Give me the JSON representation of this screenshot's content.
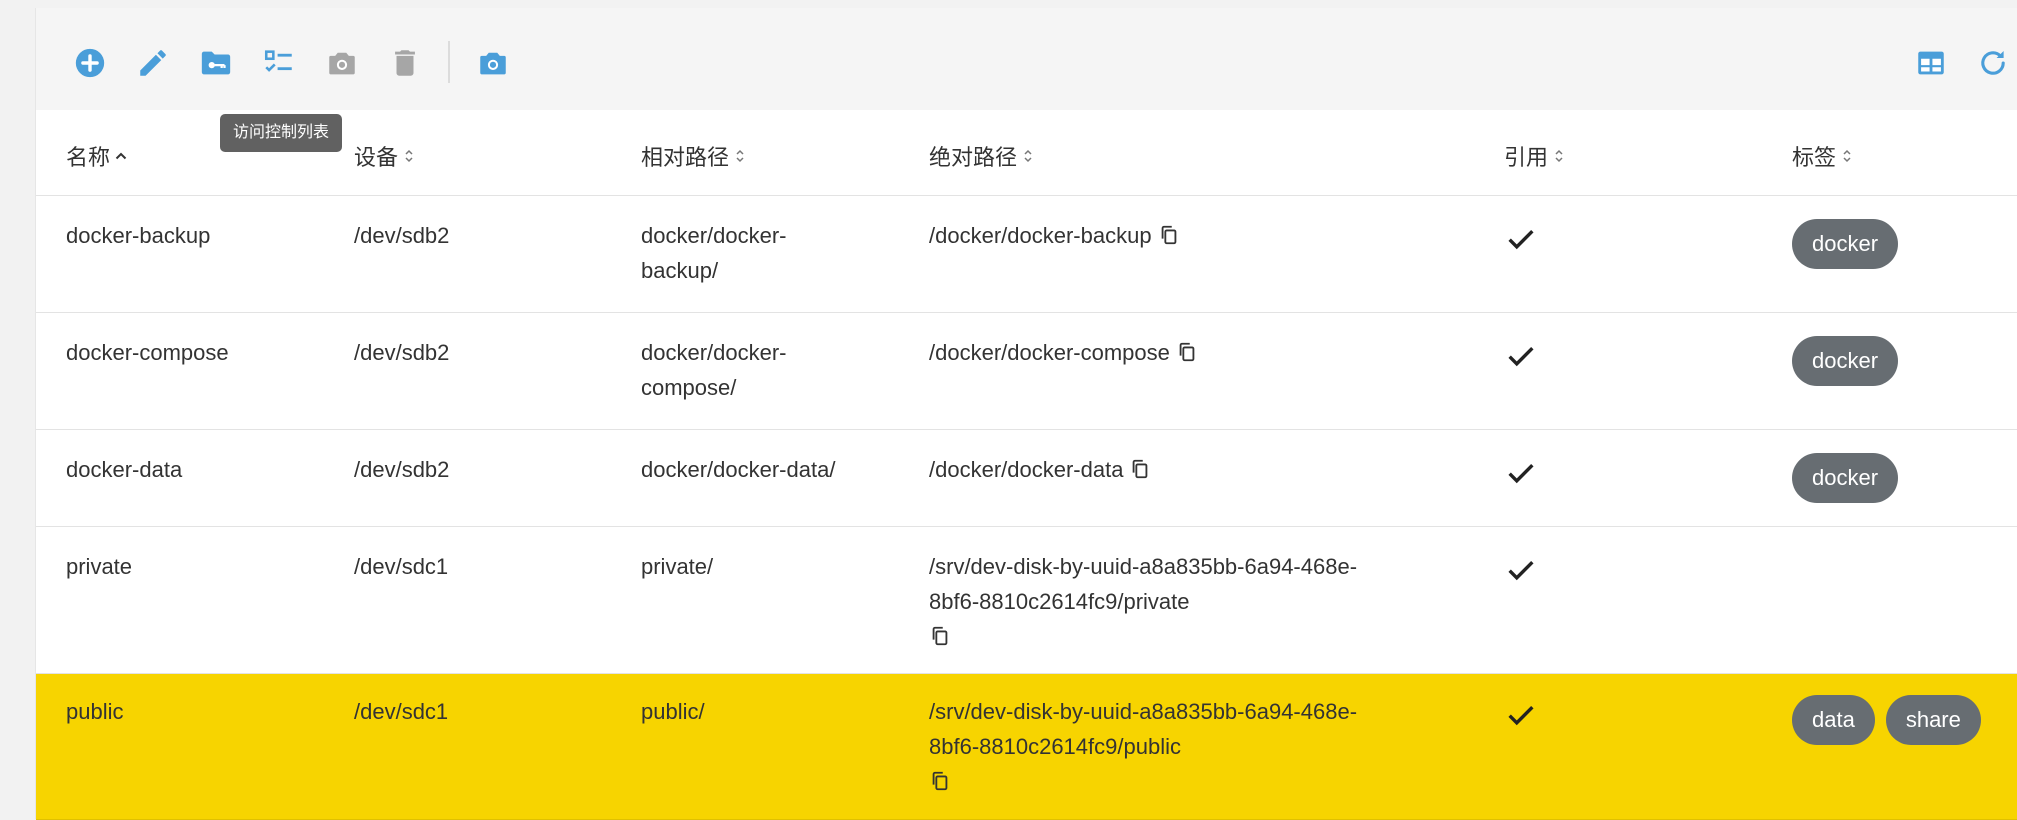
{
  "toolbar": {
    "buttons": [
      {
        "name": "add-button",
        "icon": "plus-circle-icon",
        "color": "#4a9ed9"
      },
      {
        "name": "edit-button",
        "icon": "pencil-icon",
        "color": "#4a9ed9"
      },
      {
        "name": "permissions-button",
        "icon": "folder-key-icon",
        "color": "#4a9ed9"
      },
      {
        "name": "acl-button",
        "icon": "checklist-icon",
        "color": "#4a9ed9"
      },
      {
        "name": "snapshot-button",
        "icon": "camera-icon",
        "color": "#a6a6a6"
      },
      {
        "name": "delete-button",
        "icon": "trash-icon",
        "color": "#a6a6a6"
      },
      {
        "name": "snapshots-button",
        "icon": "camera-icon",
        "color": "#4a9ed9"
      },
      {
        "name": "columns-button",
        "icon": "table-layout-icon",
        "color": "#4a9ed9"
      },
      {
        "name": "refresh-button",
        "icon": "refresh-icon",
        "color": "#4a9ed9"
      }
    ],
    "tooltip": "访问控制列表"
  },
  "columns": [
    {
      "label": "名称",
      "sort": "asc"
    },
    {
      "label": "设备",
      "sort": "none"
    },
    {
      "label": "相对路径",
      "sort": "none"
    },
    {
      "label": "绝对路径",
      "sort": "none"
    },
    {
      "label": "引用",
      "sort": "none"
    },
    {
      "label": "标签",
      "sort": "none"
    }
  ],
  "rows": [
    {
      "name": "docker-backup",
      "device": "/dev/sdb2",
      "rel1": "docker/docker-",
      "rel2": "backup/",
      "abs1": "/docker/docker-backup",
      "abs2": "",
      "referenced": true,
      "tags": [
        "docker"
      ],
      "selected": false
    },
    {
      "name": "docker-compose",
      "device": "/dev/sdb2",
      "rel1": "docker/docker-",
      "rel2": "compose/",
      "abs1": "/docker/docker-compose",
      "abs2": "",
      "referenced": true,
      "tags": [
        "docker"
      ],
      "selected": false
    },
    {
      "name": "docker-data",
      "device": "/dev/sdb2",
      "rel1": "docker/docker-data/",
      "rel2": "",
      "abs1": "/docker/docker-data",
      "abs2": "",
      "referenced": true,
      "tags": [
        "docker"
      ],
      "selected": false
    },
    {
      "name": "private",
      "device": "/dev/sdc1",
      "rel1": "private/",
      "rel2": "",
      "abs1": "/srv/dev-disk-by-uuid-a8a835bb-6a94-468e-",
      "abs2": "8bf6-8810c2614fc9/private",
      "referenced": true,
      "tags": [],
      "selected": false
    },
    {
      "name": "public",
      "device": "/dev/sdc1",
      "rel1": "public/",
      "rel2": "",
      "abs1": "/srv/dev-disk-by-uuid-a8a835bb-6a94-468e-",
      "abs2": "8bf6-8810c2614fc9/public",
      "referenced": true,
      "tags": [
        "data",
        "share"
      ],
      "selected": true
    }
  ],
  "colors": {
    "accent": "#4a9ed9",
    "disabled": "#a6a6a6",
    "selected_row": "#f7d400",
    "chip": "#676d72"
  }
}
